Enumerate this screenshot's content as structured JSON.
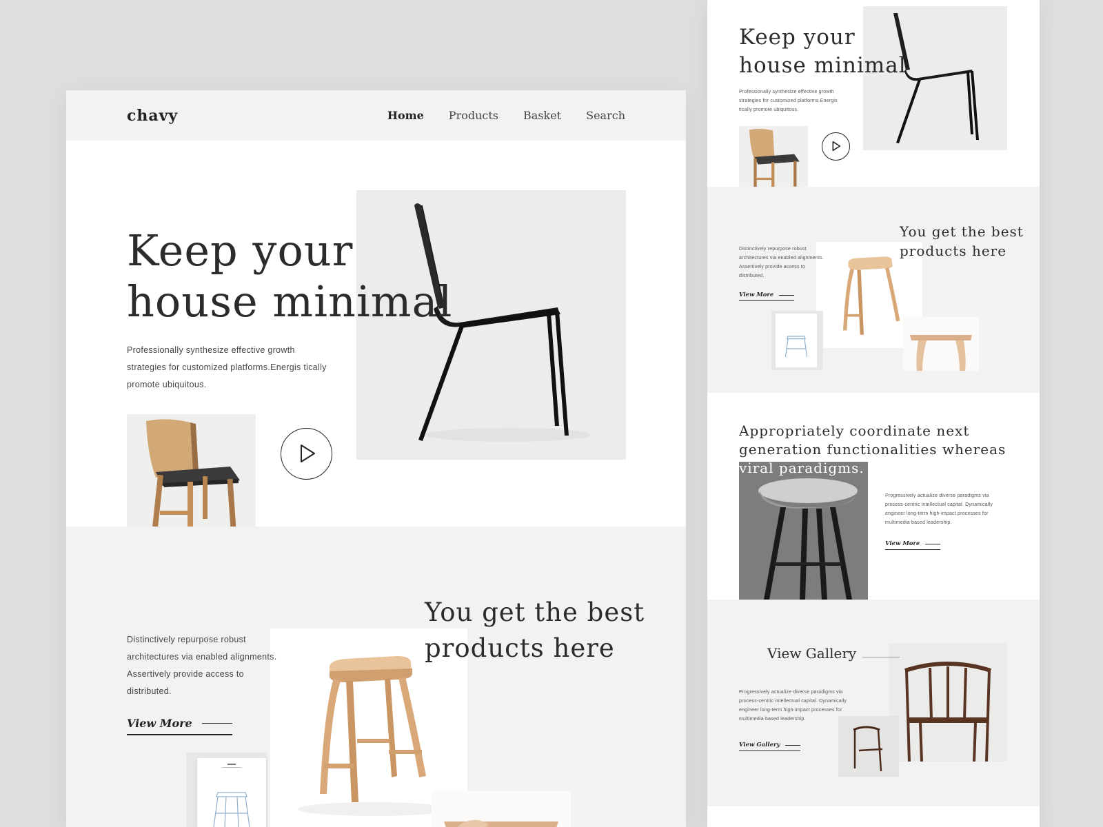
{
  "brand": {
    "logo": "chavy"
  },
  "nav": {
    "items": [
      "Home",
      "Products",
      "Basket",
      "Search"
    ],
    "active": "Home"
  },
  "hero": {
    "title_line1": "Keep your",
    "title_line2": "house minimal",
    "text": "Professionally synthesize effective growth strategies for customized platforms.Energis tically promote ubiquitous."
  },
  "products": {
    "title_line1": "You get the best",
    "title_line2": "products here",
    "text": "Distinctively repurpose robust architectures via enabled alignments. Assertively provide access to distributed.",
    "link": "View More"
  },
  "coordinate": {
    "title_line1": "Appropriately coordinate next",
    "title_line2": "generation functionalities whereas",
    "title_line3": "viral paradigms.",
    "text": "Progressively actualize diverse paradigms via process-centric intellectual capital. Dynamically engineer long-term high-impact processes for multimedia based leadership.",
    "link": "View More"
  },
  "gallery": {
    "title": "View Gallery",
    "text": "Progressively actualize diverse paradigms via process-centric intellectual capital. Dynamically engineer long-term high-impact processes for multimedia based leadership.",
    "link": "View Gallery"
  },
  "colors": {
    "background": "#dedede",
    "header": "#f2f2f2",
    "text": "#2b2b2b",
    "wood": "#c99a6b",
    "chair_black": "#1a1a1a"
  }
}
